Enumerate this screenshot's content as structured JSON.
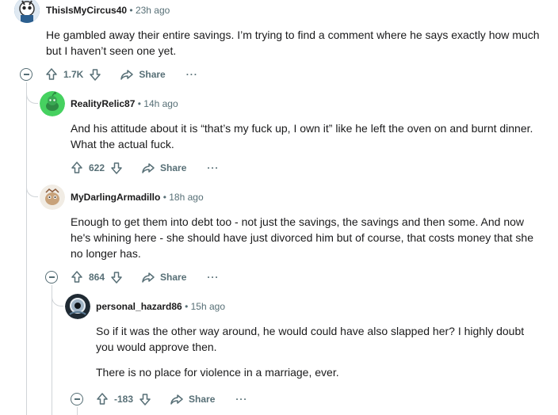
{
  "comments": [
    {
      "author": "ThisIsMyCircus40",
      "time": "23h ago",
      "body": [
        "He gambled away their entire savings. I’m trying to find a comment where he says exactly how much but I haven’t seen one yet."
      ],
      "votes": "1.7K",
      "share_label": "Share",
      "more_label": "···"
    },
    {
      "author": "RealityRelic87",
      "time": "14h ago",
      "body": [
        "And his attitude about it is “that’s my fuck up, I own it” like he left the oven on and burnt dinner. What the actual fuck."
      ],
      "votes": "622",
      "share_label": "Share",
      "more_label": "···"
    },
    {
      "author": "MyDarlingArmadillo",
      "time": "18h ago",
      "body": [
        "Enough to get them into debt too - not just the savings, the savings and then some. And now he's whining here - she should have just divorced him but of course, that costs money that she no longer has."
      ],
      "votes": "864",
      "share_label": "Share",
      "more_label": "···"
    },
    {
      "author": "personal_hazard86",
      "time": "15h ago",
      "body": [
        "So if it was the other way around, he would could have also slapped her? I highly doubt you would approve then.",
        "There is no place for violence in a marriage, ever."
      ],
      "votes": "-183",
      "share_label": "Share",
      "more_label": "···"
    }
  ],
  "separator": "•"
}
